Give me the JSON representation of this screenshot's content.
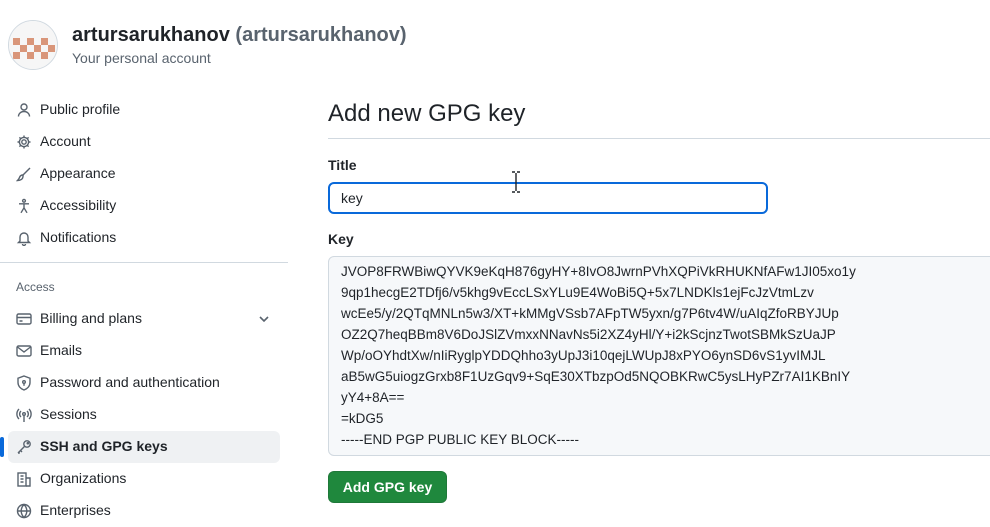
{
  "header": {
    "display_name": "artursarukhanov",
    "login": "(artursarukhanov)",
    "subtitle": "Your personal account",
    "avatar_color": "#d9967a"
  },
  "sidebar": {
    "items": [
      {
        "label": "Public profile",
        "icon": "person-icon"
      },
      {
        "label": "Account",
        "icon": "gear-icon"
      },
      {
        "label": "Appearance",
        "icon": "paintbrush-icon"
      },
      {
        "label": "Accessibility",
        "icon": "accessibility-icon"
      },
      {
        "label": "Notifications",
        "icon": "bell-icon"
      }
    ],
    "access_heading": "Access",
    "access_items": [
      {
        "label": "Billing and plans",
        "icon": "credit-card-icon"
      },
      {
        "label": "Emails",
        "icon": "mail-icon"
      },
      {
        "label": "Password and authentication",
        "icon": "shield-lock-icon"
      },
      {
        "label": "Sessions",
        "icon": "broadcast-icon"
      },
      {
        "label": "SSH and GPG keys",
        "icon": "key-icon",
        "selected": true
      },
      {
        "label": "Organizations",
        "icon": "organization-icon"
      },
      {
        "label": "Enterprises",
        "icon": "globe-icon"
      }
    ]
  },
  "main": {
    "page_title": "Add new GPG key",
    "title_label": "Title",
    "title_value": "key",
    "key_label": "Key",
    "key_lines": [
      "JVOP8FRWBiwQYVK9eKqH876gyHY+8IvO8JwrnPVhXQPiVkRHUKNfAFw1JI05xo1y",
      "9qp1hecgE2TDfj6/v5khg9vEccLSxYLu9E4WoBi5Q+5x7LNDKls1ejFcJzVtmLzv",
      "wcEe5/y/2QTqMNLn5w3/XT+kMMgVSsb7AFpTW5yxn/g7P6tv4W/uAIqZfoRBYJUp",
      "OZ2Q7heqBBm8V6DoJSlZVmxxNNavNs5i2XZ4yHl/Y+i2kScjnzTwotSBMkSzUaJP",
      "Wp/oOYhdtXw/nIiRyglpYDDQhho3yUpJ3i10qejLWUpJ8xPYO6ynSD6vS1yvIMJL",
      "aB5wG5uiogzGrxb8F1UzGqv9+SqE30XTbzpOd5NQOBKRwC5ysLHyPZr7AI1KBnIY",
      "yY4+8A==",
      "=kDG5",
      "-----END PGP PUBLIC KEY BLOCK-----"
    ],
    "submit_label": "Add GPG key"
  },
  "colors": {
    "accent": "#0969da",
    "primary_button": "#1f883d"
  }
}
